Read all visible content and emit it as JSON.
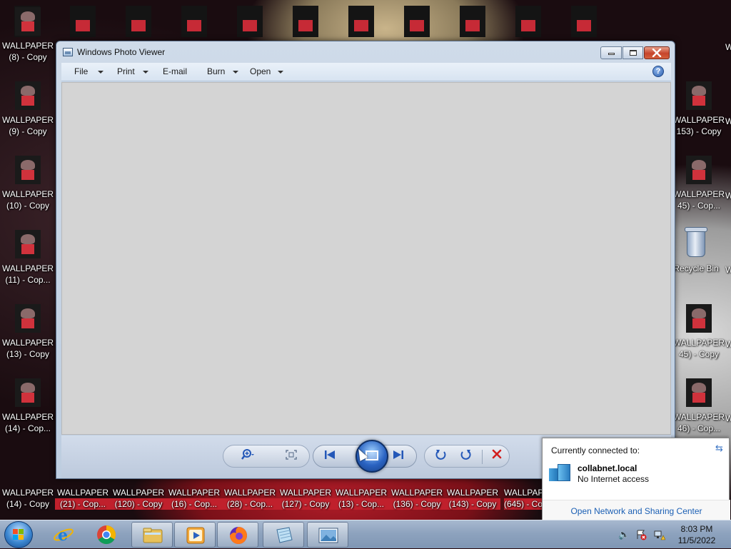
{
  "desktop": {
    "left_icons": [
      {
        "title": "WALLPAPER",
        "sub": "(8) - Copy"
      },
      {
        "title": "WALLPAPER",
        "sub": "(9) - Copy"
      },
      {
        "title": "WALLPAPER",
        "sub": "(10) - Copy"
      },
      {
        "title": "WALLPAPER",
        "sub": "(11) - Cop..."
      },
      {
        "title": "WALLPAPER",
        "sub": "(13) - Copy"
      },
      {
        "title": "WALLPAPER",
        "sub": "(14) - Cop..."
      },
      {
        "title": "WALLPAPER",
        "sub": "(14) - Copy"
      }
    ],
    "bottom_icons": [
      {
        "title": "WALLPAPER",
        "sub": "(21) - Cop..."
      },
      {
        "title": "WALLPAPER",
        "sub": "(120) - Copy"
      },
      {
        "title": "WALLPAPER",
        "sub": "(16) - Cop..."
      },
      {
        "title": "WALLPAPER",
        "sub": "(28) - Cop..."
      },
      {
        "title": "WALLPAPER",
        "sub": "(127) - Copy"
      },
      {
        "title": "WALLPAPER",
        "sub": "(13) - Cop..."
      },
      {
        "title": "WALLPAPER",
        "sub": "(136) - Copy"
      },
      {
        "title": "WALLPAPER",
        "sub": "(143) - Copy"
      },
      {
        "title": "WALLPAPER",
        "sub": "(645) - Co"
      }
    ],
    "right_icons": [
      {
        "title": "WALLPAPER",
        "sub": "153) - Copy"
      },
      {
        "title": "WALLPAPER",
        "sub": "45) - Cop..."
      },
      {
        "title": "Recycle Bin",
        "sub": ""
      },
      {
        "title": "WALLPAPER",
        "sub": "45) - Copy"
      },
      {
        "title": "WALLPAPER",
        "sub": "46) - Cop..."
      }
    ],
    "edge_letter": "W"
  },
  "photo_viewer": {
    "title": "Windows Photo Viewer",
    "menu": {
      "file": "File",
      "print": "Print",
      "email": "E-mail",
      "burn": "Burn",
      "open": "Open"
    },
    "help_glyph": "?",
    "controls": {
      "zoom_icon": "zoom-icon",
      "fit_icon": "actual-size-icon",
      "prev_icon": "previous-icon",
      "slideshow_icon": "slideshow-icon",
      "next_icon": "next-icon",
      "rotate_ccw_icon": "rotate-counterclockwise-icon",
      "rotate_cw_icon": "rotate-clockwise-icon",
      "delete_icon": "delete-icon"
    }
  },
  "network_flyout": {
    "heading": "Currently connected to:",
    "network_name": "collabnet.local",
    "status": "No Internet access",
    "link": "Open Network and Sharing Center"
  },
  "taskbar": {
    "pinned": [
      "start-orb",
      "internet-explorer-icon",
      "chrome-icon",
      "file-explorer-icon",
      "media-player-icon",
      "firefox-icon",
      "notepad-icon",
      "photo-viewer-icon"
    ],
    "clock": {
      "time": "8:03 PM",
      "date": "11/5/2022"
    }
  },
  "colors": {
    "accent": "#2458b8",
    "close_red": "#c6452c",
    "link": "#1a5fb4",
    "delete_x": "#d21f1f"
  }
}
